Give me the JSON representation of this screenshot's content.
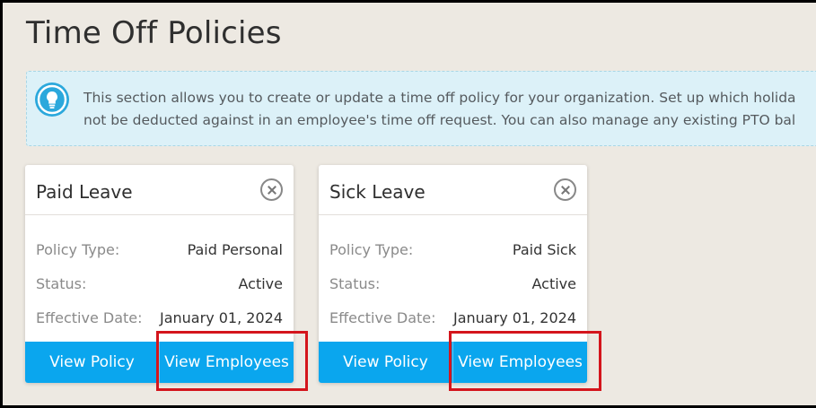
{
  "page": {
    "title": "Time Off Policies"
  },
  "info": {
    "icon": "lightbulb-icon",
    "line1": "This section allows you to create or update a time off policy for your organization. Set up which holida",
    "line2": "not be deducted against in an employee's time off request. You can also manage any existing PTO bal"
  },
  "cards": [
    {
      "title": "Paid Leave",
      "rows": [
        {
          "label": "Policy Type:",
          "value": "Paid Personal"
        },
        {
          "label": "Status:",
          "value": "Active"
        },
        {
          "label": "Effective Date:",
          "value": "January 01, 2024"
        }
      ],
      "view_policy": "View Policy",
      "view_employees": "View Employees"
    },
    {
      "title": "Sick Leave",
      "rows": [
        {
          "label": "Policy Type:",
          "value": "Paid Sick"
        },
        {
          "label": "Status:",
          "value": "Active"
        },
        {
          "label": "Effective Date:",
          "value": "January 01, 2024"
        }
      ],
      "view_policy": "View Policy",
      "view_employees": "View Employees"
    }
  ],
  "colors": {
    "page_bg": "#ede9e2",
    "info_bg": "#dcf1f8",
    "accent": "#0aa6ee",
    "highlight": "#d4151c"
  }
}
